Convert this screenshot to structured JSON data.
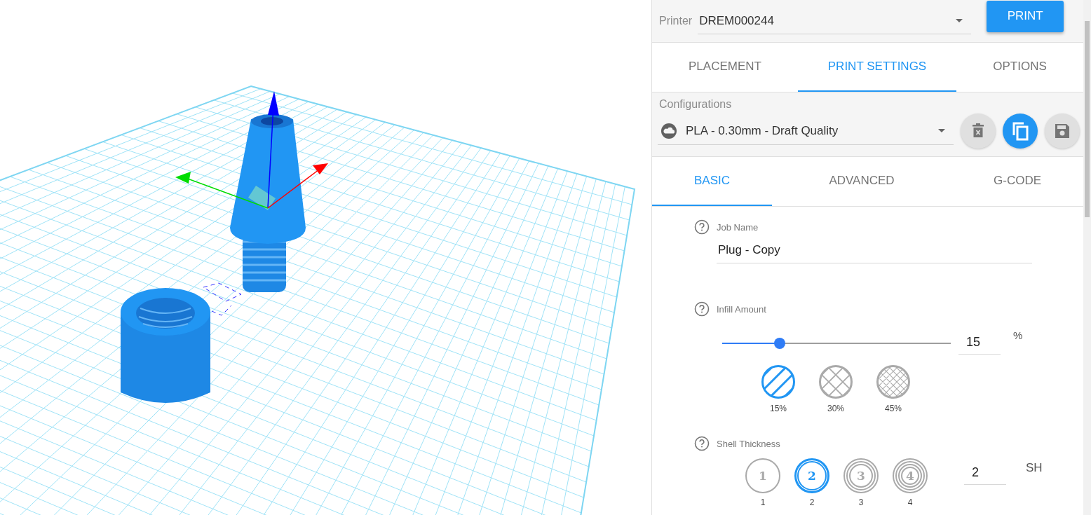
{
  "printer": {
    "label": "Printer",
    "value": "DREM000244"
  },
  "print_button": "PRINT",
  "tabs": [
    {
      "label": "PLACEMENT",
      "selected": false
    },
    {
      "label": "PRINT SETTINGS",
      "selected": true
    },
    {
      "label": "OPTIONS",
      "selected": false
    }
  ],
  "configurations": {
    "label": "Configurations",
    "value": "PLA - 0.30mm - Draft Quality"
  },
  "config_buttons": [
    {
      "kind": "delete",
      "highlighted": false
    },
    {
      "kind": "copy",
      "highlighted": true
    },
    {
      "kind": "save",
      "highlighted": false
    }
  ],
  "subtabs": [
    {
      "label": "BASIC",
      "selected": true
    },
    {
      "label": "ADVANCED",
      "selected": false
    },
    {
      "label": "G-CODE",
      "selected": false
    }
  ],
  "job_name": {
    "label": "Job Name",
    "value": "Plug - Copy"
  },
  "infill": {
    "label": "Infill Amount",
    "level": 0.25,
    "value": "15",
    "unit": "%",
    "presets": [
      {
        "kind": "lines",
        "label": "15%",
        "selected": true
      },
      {
        "kind": "grid",
        "label": "30%",
        "selected": false
      },
      {
        "kind": "fine-grid",
        "label": "45%",
        "selected": false
      }
    ]
  },
  "shell": {
    "label": "Shell Thickness",
    "value": "2",
    "unit": "SH",
    "presets": [
      {
        "kind": "single",
        "numeral": "1",
        "label": "1",
        "selected": false
      },
      {
        "kind": "double",
        "numeral": "2",
        "label": "2",
        "selected": true
      },
      {
        "kind": "triple",
        "numeral": "3",
        "label": "3",
        "selected": false
      },
      {
        "kind": "quadruple",
        "numeral": "4",
        "label": "4",
        "selected": false
      }
    ]
  }
}
